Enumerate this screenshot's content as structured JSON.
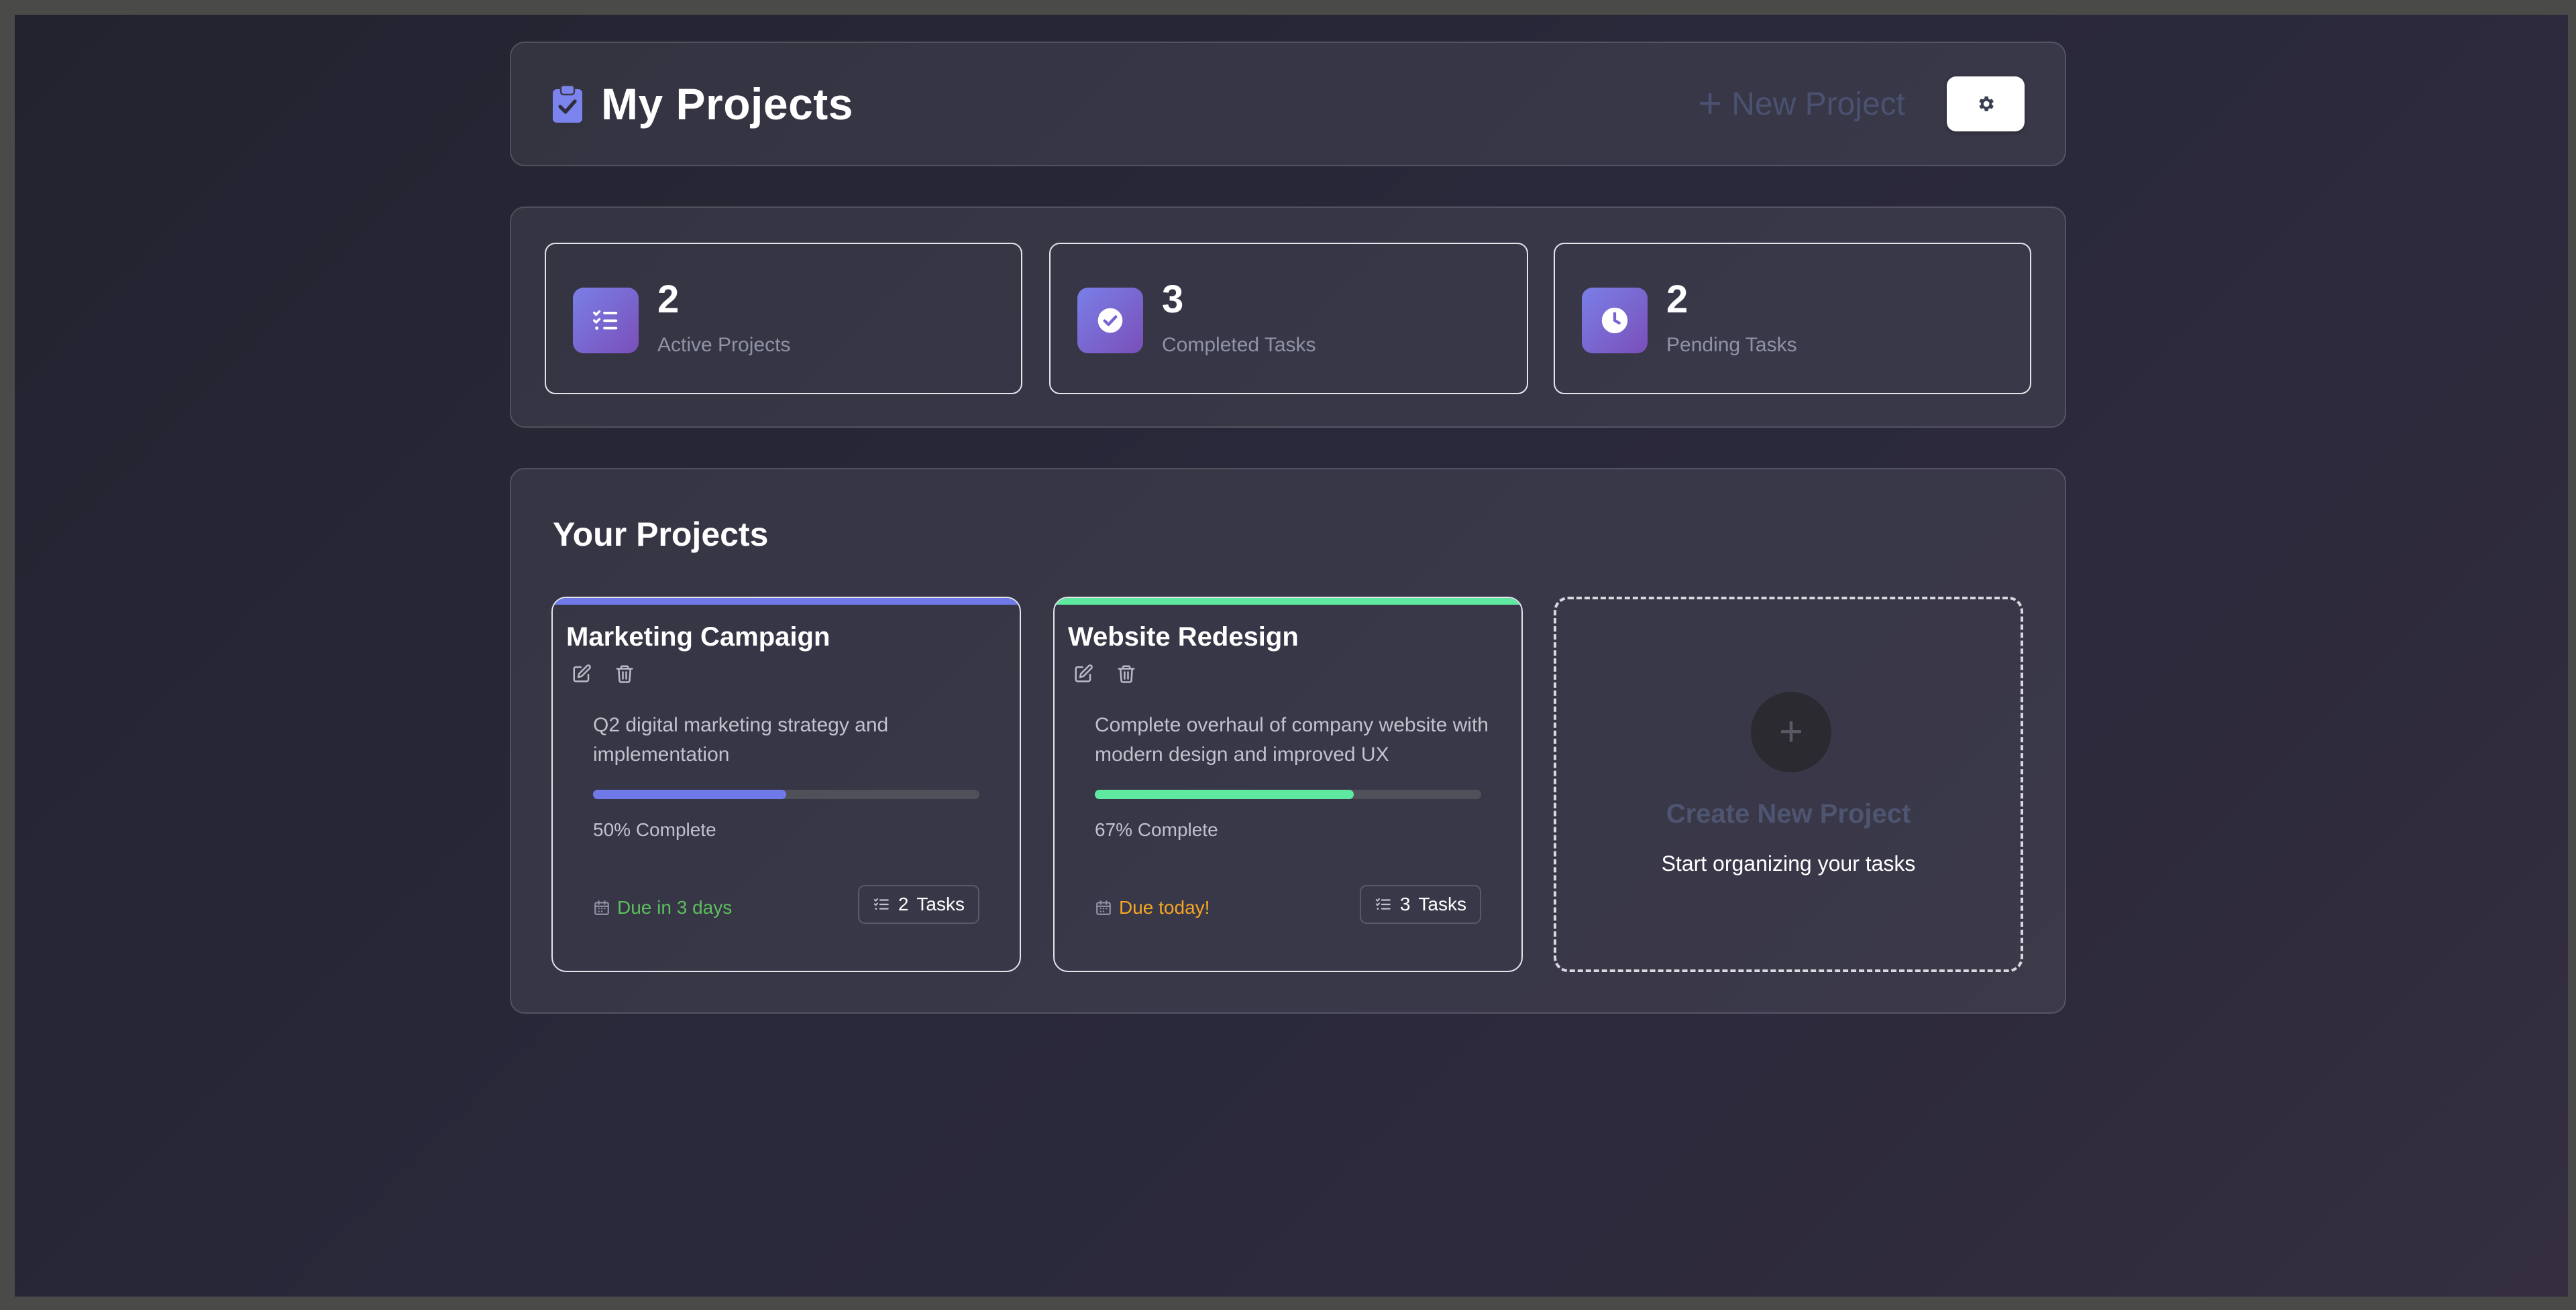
{
  "header": {
    "title": "My Projects",
    "title_icon": "clipboard-check-icon",
    "new_project_label": "New Project",
    "settings_icon": "gear-icon"
  },
  "stats": [
    {
      "value": "2",
      "label": "Active Projects",
      "icon": "list-check-icon"
    },
    {
      "value": "3",
      "label": "Completed Tasks",
      "icon": "circle-check-icon"
    },
    {
      "value": "2",
      "label": "Pending Tasks",
      "icon": "clock-icon"
    }
  ],
  "projects_section": {
    "title": "Your Projects",
    "cards": [
      {
        "name": "Marketing Campaign",
        "description": "Q2 digital marketing strategy and implementation",
        "progress": 0.5,
        "progress_label": "50% Complete",
        "due_label": "Due in 3 days",
        "task_count": "2",
        "tasks_label": "Tasks",
        "accent_color": "#6f7ae8",
        "due_color": "#5cbf5c"
      },
      {
        "name": "Website Redesign",
        "description": "Complete overhaul of company website with modern design and improved UX",
        "progress": 0.67,
        "progress_label": "67% Complete",
        "due_label": "Due today!",
        "task_count": "3",
        "tasks_label": "Tasks",
        "accent_color": "#5ee8a0",
        "due_color": "#f5a623"
      }
    ],
    "create_card": {
      "plus": "+",
      "title": "Create New Project",
      "subtitle": "Start organizing your tasks"
    }
  },
  "colors": {
    "accent_primary": "#6f7ae8",
    "accent_success": "#5ee8a0",
    "due_soon": "#5cbf5c",
    "due_today": "#f5a623"
  }
}
